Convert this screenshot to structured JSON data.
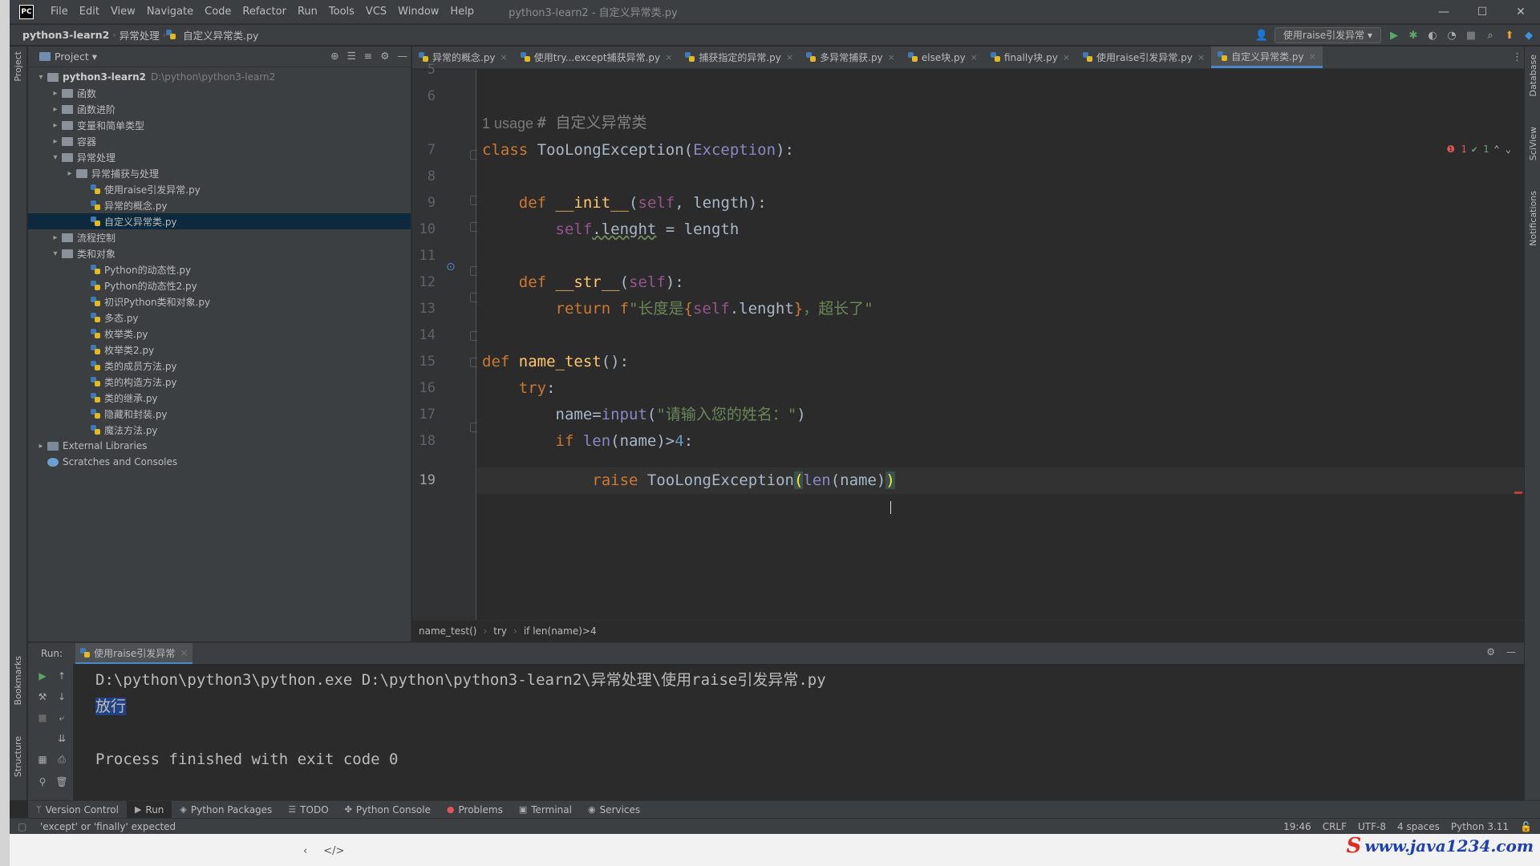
{
  "menu": [
    "File",
    "Edit",
    "View",
    "Navigate",
    "Code",
    "Refactor",
    "Run",
    "Tools",
    "VCS",
    "Window",
    "Help"
  ],
  "window_title": "python3-learn2 - 自定义异常类.py",
  "window_controls": [
    "—",
    "☐",
    "✕"
  ],
  "navbar": {
    "project": "python3-learn2",
    "folder": "异常处理",
    "file": "自定义异常类.py",
    "run_config": "使用raise引发异常 ▾"
  },
  "project_panel": {
    "title": "Project ▾",
    "tree": [
      {
        "label": "python3-learn2",
        "path": "D:\\python\\python3-learn2",
        "indent": 0,
        "kind": "root",
        "arrow": "▾"
      },
      {
        "label": "函数",
        "indent": 1,
        "kind": "folder",
        "arrow": "▸"
      },
      {
        "label": "函数进阶",
        "indent": 1,
        "kind": "folder",
        "arrow": "▸"
      },
      {
        "label": "变量和简单类型",
        "indent": 1,
        "kind": "folder",
        "arrow": "▸"
      },
      {
        "label": "容器",
        "indent": 1,
        "kind": "folder",
        "arrow": "▸"
      },
      {
        "label": "异常处理",
        "indent": 1,
        "kind": "folder",
        "arrow": "▾"
      },
      {
        "label": "异常捕获与处理",
        "indent": 2,
        "kind": "folder",
        "arrow": "▸"
      },
      {
        "label": "使用raise引发异常.py",
        "indent": 3,
        "kind": "file"
      },
      {
        "label": "异常的概念.py",
        "indent": 3,
        "kind": "file"
      },
      {
        "label": "自定义异常类.py",
        "indent": 3,
        "kind": "file",
        "selected": true
      },
      {
        "label": "流程控制",
        "indent": 1,
        "kind": "folder",
        "arrow": "▸"
      },
      {
        "label": "类和对象",
        "indent": 1,
        "kind": "folder",
        "arrow": "▾"
      },
      {
        "label": "Python的动态性.py",
        "indent": 3,
        "kind": "file"
      },
      {
        "label": "Python的动态性2.py",
        "indent": 3,
        "kind": "file"
      },
      {
        "label": "初识Python类和对象.py",
        "indent": 3,
        "kind": "file"
      },
      {
        "label": "多态.py",
        "indent": 3,
        "kind": "file"
      },
      {
        "label": "枚举类.py",
        "indent": 3,
        "kind": "file"
      },
      {
        "label": "枚举类2.py",
        "indent": 3,
        "kind": "file"
      },
      {
        "label": "类的成员方法.py",
        "indent": 3,
        "kind": "file"
      },
      {
        "label": "类的构造方法.py",
        "indent": 3,
        "kind": "file"
      },
      {
        "label": "类的继承.py",
        "indent": 3,
        "kind": "file"
      },
      {
        "label": "隐藏和封装.py",
        "indent": 3,
        "kind": "file"
      },
      {
        "label": "魔法方法.py",
        "indent": 3,
        "kind": "file"
      },
      {
        "label": "External Libraries",
        "indent": 0,
        "kind": "lib",
        "arrow": "▸"
      },
      {
        "label": "Scratches and Consoles",
        "indent": 0,
        "kind": "scratch"
      }
    ]
  },
  "editor_tabs": [
    {
      "label": "异常的概念.py"
    },
    {
      "label": "使用try...except捕获异常.py"
    },
    {
      "label": "捕获指定的异常.py"
    },
    {
      "label": "多异常捕获.py"
    },
    {
      "label": "else块.py"
    },
    {
      "label": "finally块.py"
    },
    {
      "label": "使用raise引发异常.py"
    },
    {
      "label": "自定义异常类.py",
      "active": true
    }
  ],
  "inspection": {
    "errors": "❶ 1",
    "warnings": "✔ 1",
    "nav": "⌃ ⌄"
  },
  "line_numbers": [
    "5",
    "6",
    "",
    "7",
    "8",
    "9",
    "10",
    "11",
    "12",
    "13",
    "14",
    "15",
    "16",
    "17",
    "18",
    "19"
  ],
  "code": {
    "l6": "# 自定义异常类",
    "usage": "1 usage",
    "l7_kw": "class ",
    "l7_name": "TooLongException(",
    "l7_base": "Exception",
    "l7_end": "):",
    "l9_kw": "def ",
    "l9_fn": "__init__",
    "l9_open": "(",
    "l9_self": "self",
    "l9_rest": ", length):",
    "l10_self": "self",
    "l10_attr": ".lenght",
    "l10_rest": " = length",
    "l12_kw": "def ",
    "l12_fn": "__str__",
    "l12_open": "(",
    "l12_self": "self",
    "l12_end": "):",
    "l13_kw": "return ",
    "l13_f": "f",
    "l13_s1": "\"长度是",
    "l13_b1": "{",
    "l13_self": "self",
    "l13_attr": ".lenght",
    "l13_b2": "}",
    "l13_s2": "，超长了\"",
    "l15_kw": "def ",
    "l15_fn": "name_test",
    "l15_end": "():",
    "l16_kw": "try",
    "l16_end": ":",
    "l17_a": "name=",
    "l17_input": "input",
    "l17_open": "(",
    "l17_str": "\"请输入您的姓名：\"",
    "l17_close": ")",
    "l18_kw": "if ",
    "l18_len": "len",
    "l18_rest": "(name)>",
    "l18_num": "4",
    "l18_end": ":",
    "l19_kw": "raise ",
    "l19_cls": "TooLongException",
    "l19_open": "(",
    "l19_len": "len",
    "l19_mid": "(name)",
    "l19_close": ")"
  },
  "editor_breadcrumb": [
    "name_test()",
    "try",
    "if len(name)>4"
  ],
  "run_panel": {
    "label": "Run:",
    "tab": "使用raise引发异常",
    "console": {
      "cmd": "D:\\python\\python3\\python.exe D:\\python\\python3-learn2\\异常处理\\使用raise引发异常.py",
      "output": "放行",
      "exit": "Process finished with exit code 0"
    }
  },
  "left_stripe": [
    "Project",
    "Bookmarks",
    "Structure"
  ],
  "right_stripe": [
    "Database",
    "SciView",
    "Notifications"
  ],
  "tool_tabs": [
    {
      "icon": "ᛘ",
      "label": "Version Control"
    },
    {
      "icon": "▶",
      "label": "Run",
      "active": true
    },
    {
      "icon": "◈",
      "label": "Python Packages"
    },
    {
      "icon": "☰",
      "label": "TODO"
    },
    {
      "icon": "✤",
      "label": "Python Console"
    },
    {
      "icon": "●",
      "label": "Problems"
    },
    {
      "icon": "▣",
      "label": "Terminal"
    },
    {
      "icon": "◉",
      "label": "Services"
    }
  ],
  "status": {
    "message": "'except' or 'finally' expected",
    "position": "19:46",
    "line_sep": "CRLF",
    "encoding": "UTF-8",
    "indent": "4 spaces",
    "interpreter": "Python 3.11"
  },
  "below_nav": [
    "‹",
    "</>"
  ],
  "watermark": {
    "s": "S",
    "text": "www.java1234.com"
  }
}
